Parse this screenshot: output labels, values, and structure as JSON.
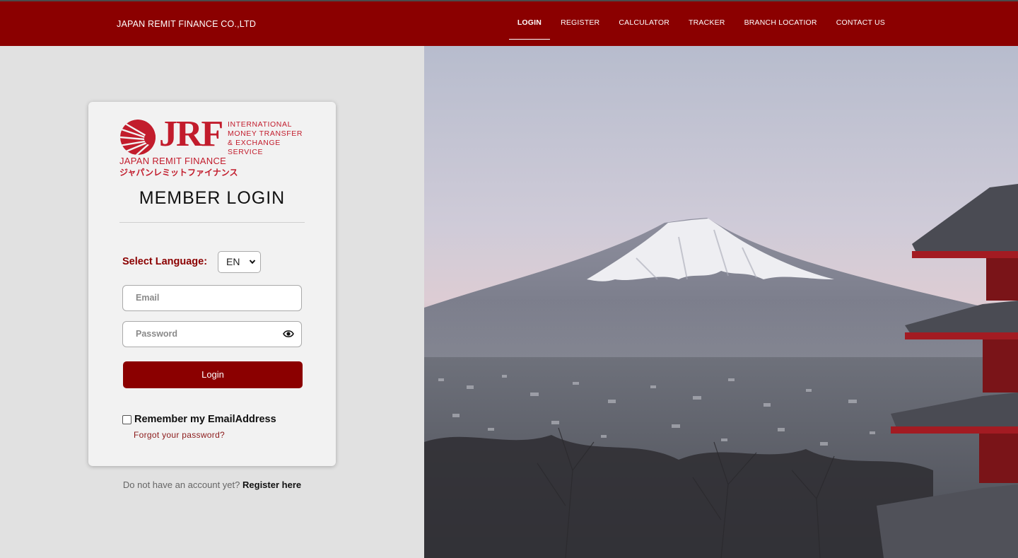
{
  "header": {
    "brand": "JAPAN REMIT FINANCE CO.,LTD",
    "nav": [
      {
        "label": "LOGIN",
        "active": true
      },
      {
        "label": "REGISTER",
        "active": false
      },
      {
        "label": "CALCULATOR",
        "active": false
      },
      {
        "label": "TRACKER",
        "active": false
      },
      {
        "label": "BRANCH LOCATIOR",
        "active": false
      },
      {
        "label": "CONTACT US",
        "active": false
      }
    ]
  },
  "logo": {
    "mark": "JRF",
    "tagline": [
      "INTERNATIONAL",
      "MONEY TRANSFER",
      "& EXCHANGE",
      "SERVICE"
    ],
    "name": "JAPAN REMIT FINANCE",
    "name_jp": "ジャパンレミットファイナンス"
  },
  "login": {
    "title": "MEMBER LOGIN",
    "language_label": "Select Language:",
    "language_value": "EN",
    "email_placeholder": "Email",
    "password_placeholder": "Password",
    "login_button": "Login",
    "remember_label": "Remember my EmailAddress",
    "remember_checked": false,
    "forgot_link": "Forgot your password?"
  },
  "footer": {
    "no_account_text": "Do not have an account yet?",
    "register_link": "Register here"
  },
  "colors": {
    "brand": "#8b0000",
    "logo_red": "#c21c2c",
    "panel_bg": "#e1e1e1"
  },
  "icons": [
    "eye-icon",
    "chevron-down-icon",
    "jrf-sun-logo-icon"
  ]
}
